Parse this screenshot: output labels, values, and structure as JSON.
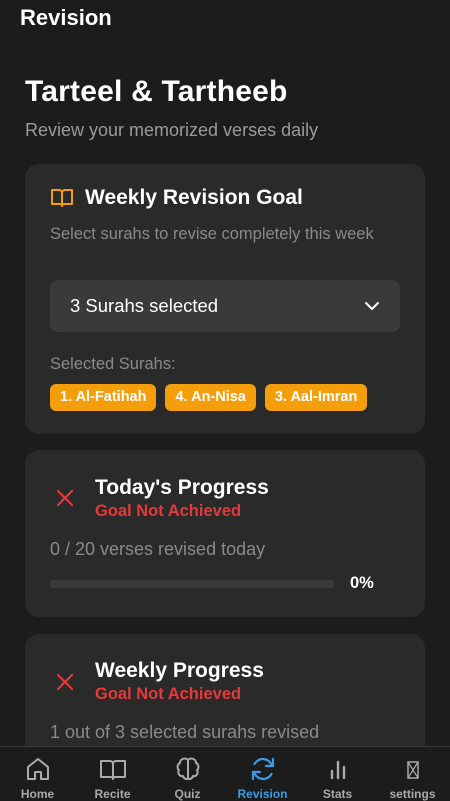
{
  "app": {
    "title": "Revision"
  },
  "header": {
    "title": "Tarteel & Tartheeb",
    "subtitle": "Review your memorized verses daily"
  },
  "goal_card": {
    "icon": "book-open-icon",
    "title": "Weekly Revision Goal",
    "description": "Select surahs to revise completely this week",
    "dropdown_value": "3 Surahs selected",
    "selected_label": "Selected Surahs:",
    "chips": [
      "1. Al-Fatihah",
      "4. An-Nisa",
      "3. Aal-Imran"
    ]
  },
  "today_progress": {
    "icon": "close-icon",
    "title": "Today's Progress",
    "status": "Goal Not Achieved",
    "text": "0 / 20 verses revised today",
    "progress": 0,
    "percent_label": "0%"
  },
  "weekly_progress": {
    "icon": "close-icon",
    "title": "Weekly Progress",
    "status": "Goal Not Achieved",
    "text": "1 out of 3 selected surahs revised"
  },
  "nav": {
    "active": "Revision",
    "items": [
      {
        "label": "Home",
        "icon": "home-icon"
      },
      {
        "label": "Recite",
        "icon": "book-icon"
      },
      {
        "label": "Quiz",
        "icon": "brain-icon"
      },
      {
        "label": "Revision",
        "icon": "refresh-icon"
      },
      {
        "label": "Stats",
        "icon": "bar-chart-icon"
      },
      {
        "label": "settings",
        "icon": "missing-glyph-icon"
      }
    ]
  },
  "colors": {
    "background": "#1c1c1c",
    "card": "#2a2a2a",
    "accent_orange": "#f59e0b",
    "error_red": "#e5393b",
    "active_blue": "#3b9be8"
  }
}
